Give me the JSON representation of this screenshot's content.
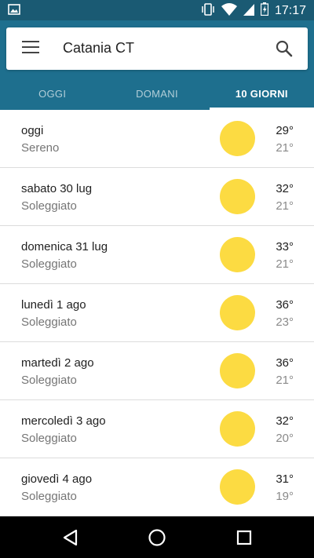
{
  "status_bar": {
    "time": "17:17"
  },
  "search": {
    "city": "Catania CT"
  },
  "tabs": [
    {
      "label": "OGGI",
      "active": false
    },
    {
      "label": "DOMANI",
      "active": false
    },
    {
      "label": "10 GIORNI",
      "active": true
    }
  ],
  "forecast": [
    {
      "day": "oggi",
      "condition": "Sereno",
      "high": "29°",
      "low": "21°",
      "icon": "sun-icon"
    },
    {
      "day": "sabato 30 lug",
      "condition": "Soleggiato",
      "high": "32°",
      "low": "21°",
      "icon": "sun-icon"
    },
    {
      "day": "domenica 31 lug",
      "condition": "Soleggiato",
      "high": "33°",
      "low": "21°",
      "icon": "sun-icon"
    },
    {
      "day": "lunedì 1 ago",
      "condition": "Soleggiato",
      "high": "36°",
      "low": "23°",
      "icon": "sun-icon"
    },
    {
      "day": "martedì 2 ago",
      "condition": "Soleggiato",
      "high": "36°",
      "low": "21°",
      "icon": "sun-icon"
    },
    {
      "day": "mercoledì 3 ago",
      "condition": "Soleggiato",
      "high": "32°",
      "low": "20°",
      "icon": "sun-icon"
    },
    {
      "day": "giovedì 4 ago",
      "condition": "Soleggiato",
      "high": "31°",
      "low": "19°",
      "icon": "sun-icon"
    }
  ],
  "colors": {
    "header": "#1e6f8e",
    "status_bar": "#1a5a73",
    "sun": "#fcdb42"
  },
  "icons": {
    "status_left": "image-icon",
    "status_right": [
      "vibrate-icon",
      "wifi-icon",
      "signal-icon",
      "battery-icon"
    ],
    "nav": [
      "back-icon",
      "home-icon",
      "recents-icon"
    ]
  }
}
